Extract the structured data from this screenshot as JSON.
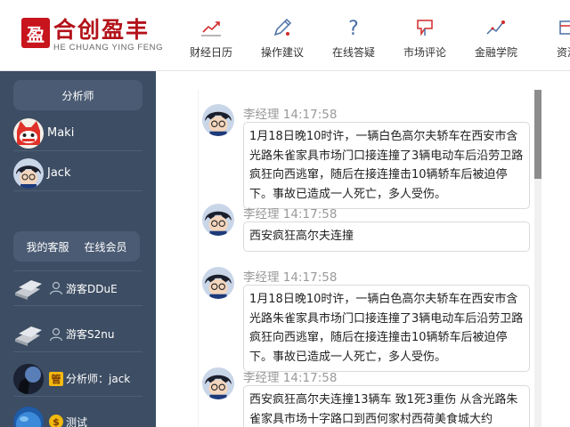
{
  "brand": {
    "seal_char": "盈",
    "name_cn": "合创盈丰",
    "name_en": "HE CHUANG YING FENG",
    "color": "#c8141c"
  },
  "nav": [
    {
      "label": "财经日历",
      "icon": "trend-chart-icon"
    },
    {
      "label": "操作建议",
      "icon": "pencil-icon"
    },
    {
      "label": "在线答疑",
      "icon": "question-mark-icon"
    },
    {
      "label": "市场评论",
      "icon": "flag-icon"
    },
    {
      "label": "金融学院",
      "icon": "line-chart-icon"
    },
    {
      "label": "资源",
      "icon": "resource-icon"
    }
  ],
  "sidebar": {
    "analyst_tab": "分析师",
    "analysts": [
      {
        "name": "Maki",
        "avatar": "red-cat-avatar"
      },
      {
        "name": "Jack",
        "avatar": "anime-boy-avatar"
      }
    ],
    "tabs": [
      "我的客服",
      "在线会员"
    ],
    "members": [
      {
        "name": "游客DDuE",
        "avatar": "silver-bars-avatar",
        "icon": "user-outline-icon"
      },
      {
        "name": "游客S2nu",
        "avatar": "silver-bars-avatar",
        "icon": "user-outline-icon"
      },
      {
        "name": "分析师：jack",
        "avatar": "dark-figure-avatar",
        "icon": "vip-badge-icon",
        "badge_char": "管"
      },
      {
        "name": "测试",
        "avatar": "blue-globe-avatar",
        "icon": "coin-badge-icon",
        "badge_char": "$"
      }
    ]
  },
  "colors": {
    "sidebar_bg": "#3d4d63",
    "tab_bg": "#4a5b73",
    "accent_red": "#c8141c"
  },
  "messages": [
    {
      "sender": "李经理",
      "time": "14:17:58",
      "text": "1月18日晚10时许，一辆白色高尔夫轿车在西安市含光路朱雀家具市场门口接连撞了3辆电动车后沿劳卫路疯狂向西逃窜，随后在接连撞击10辆轿车后被迫停下。事故已造成一人死亡，多人受伤。"
    },
    {
      "sender": "李经理",
      "time": "14:17:58",
      "text": "西安疯狂高尔夫连撞"
    },
    {
      "sender": "李经理",
      "time": "14:17:58",
      "text": "1月18日晚10时许，一辆白色高尔夫轿车在西安市含光路朱雀家具市场门口接连撞了3辆电动车后沿劳卫路疯狂向西逃窜，随后在接连撞击10辆轿车后被迫停下。事故已造成一人死亡，多人受伤。"
    },
    {
      "sender": "李经理",
      "time": "14:17:58",
      "text": "西安疯狂高尔夫连撞13辆车 致1死3重伤 从含光路朱雀家具市场十字路口到西何家村西荷美食城大约"
    }
  ]
}
